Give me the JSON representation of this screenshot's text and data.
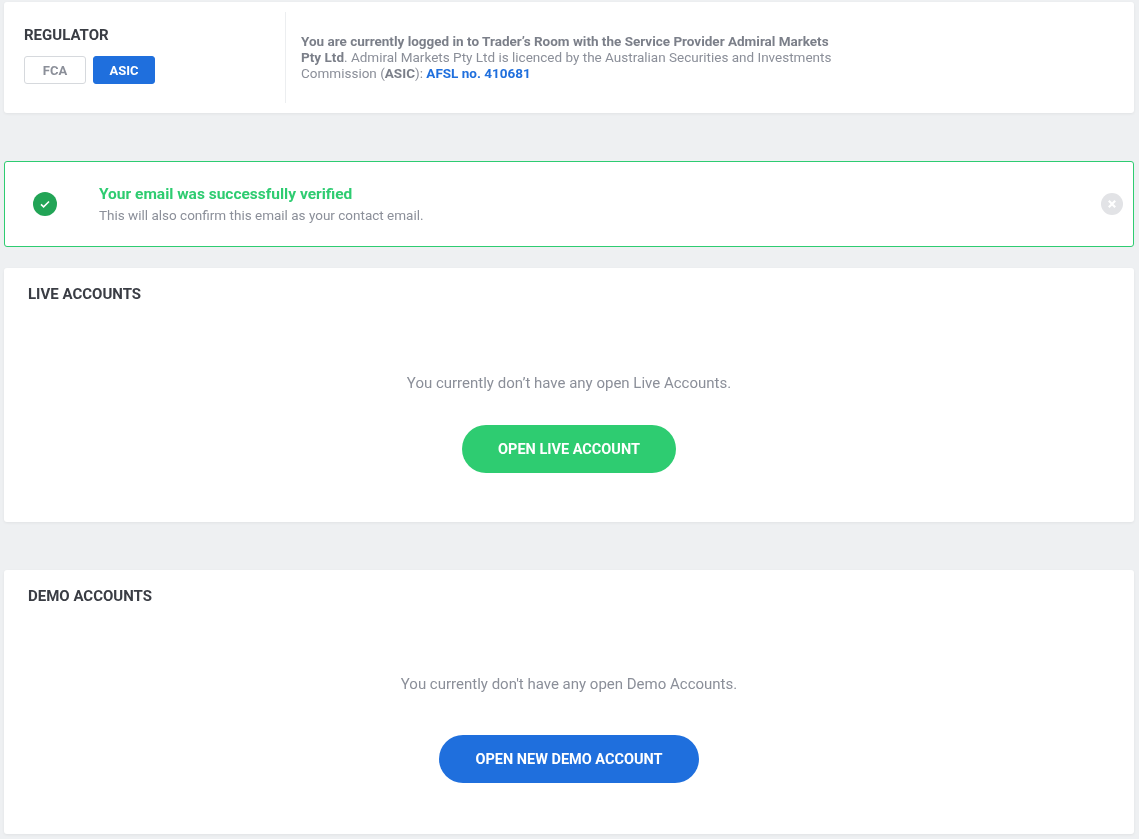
{
  "regulator": {
    "title": "REGULATOR",
    "options": [
      {
        "label": "FCA",
        "selected": false
      },
      {
        "label": "ASIC",
        "selected": true
      }
    ],
    "info": "**You are currently logged in to Trader’s Room with the Service Provider Admiral Markets Pty Ltd**. Admiral Markets Pty Ltd is licenced by the Australian Securities and Investments Commission (**ASIC**):",
    "info_link": "AFSL no. 410681"
  },
  "alert": {
    "title": "Your email was successfully verified",
    "message": "This will also confirm this email as your contact email."
  },
  "sections": [
    {
      "title": "LIVE ACCOUNTS",
      "message": "You currently don’t have any open Live Accounts.",
      "button": {
        "label": "OPEN LIVE ACCOUNT",
        "kind": "success"
      }
    },
    {
      "title": "DEMO ACCOUNTS",
      "message": "You currently don't have any open Demo Accounts.",
      "button": {
        "label": "OPEN NEW DEMO ACCOUNT",
        "kind": "primary"
      }
    }
  ]
}
